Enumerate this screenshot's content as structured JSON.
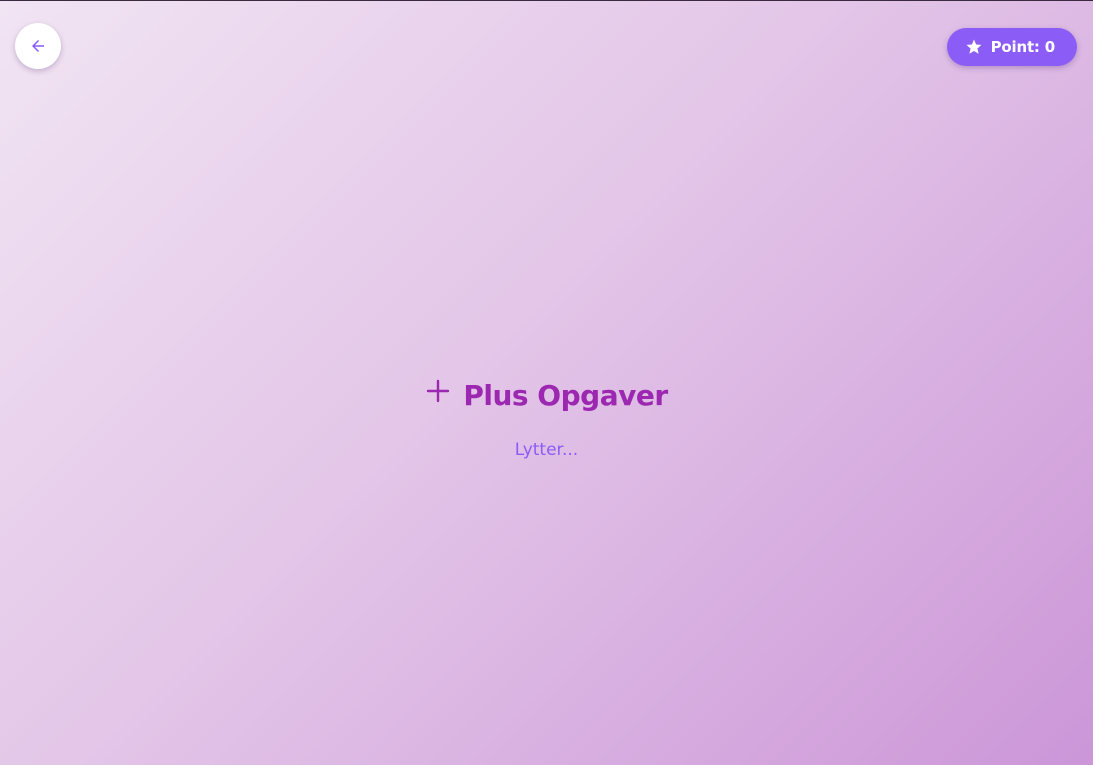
{
  "header": {
    "back_icon": "arrow-left-icon",
    "points_icon": "star-icon",
    "points_label": "Point: 0"
  },
  "main": {
    "title_icon": "plus-icon",
    "title": "Plus Opgaver",
    "status": "Lytter..."
  },
  "colors": {
    "accent": "#8b5cf6",
    "title": "#9c27b0",
    "background_start": "#f1e4f3",
    "background_end": "#cc96d8"
  }
}
